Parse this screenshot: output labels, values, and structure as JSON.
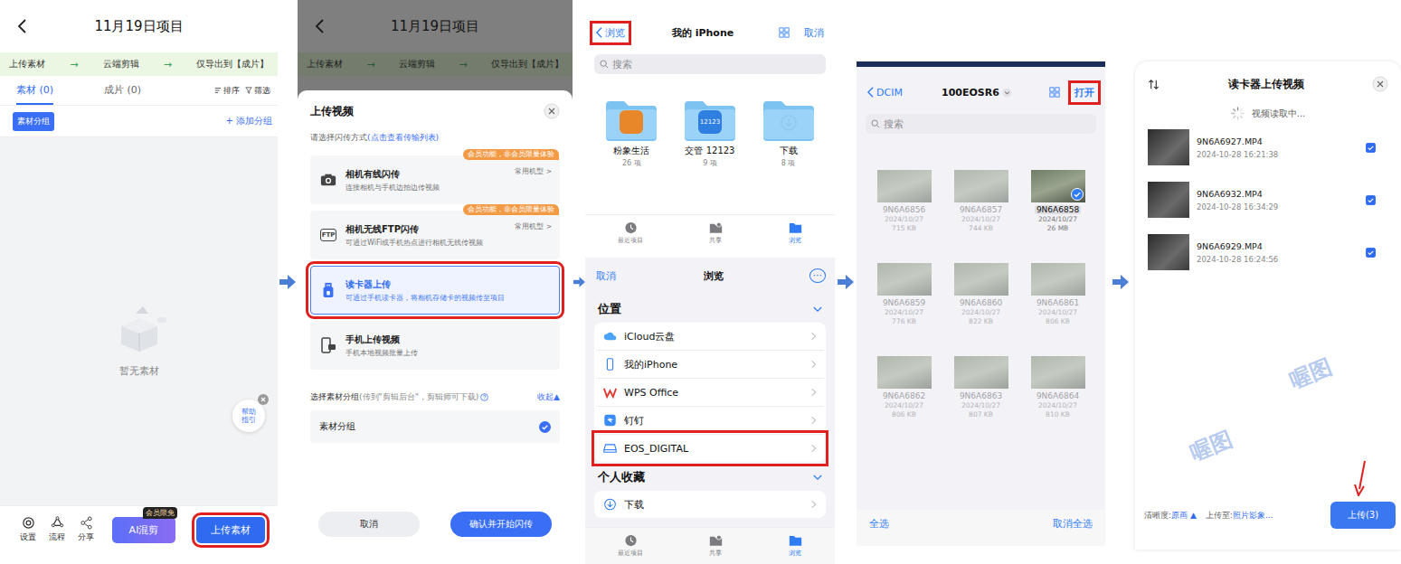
{
  "project": {
    "title": "11月19日项目",
    "steps": [
      "上传素材",
      "云端剪辑",
      "仅导出到【成片】"
    ],
    "step_arrow": "→",
    "tabs": [
      {
        "label": "素材 (0)",
        "selected": true
      },
      {
        "label": "成片 (0)",
        "selected": false
      }
    ],
    "tools": [
      {
        "label": "排序",
        "kind": "sort"
      },
      {
        "label": "筛选",
        "kind": "filter"
      }
    ],
    "group_button": "素材分组",
    "add_group": "+ 添加分组",
    "empty": "暂无素材",
    "help": [
      "帮助",
      "指引"
    ],
    "actions": [
      {
        "label": "设置",
        "kind": "gear"
      },
      {
        "label": "流程",
        "kind": "flow"
      },
      {
        "label": "分享",
        "kind": "share"
      }
    ],
    "ai_button": "AI混剪",
    "ai_badge": "会员限免",
    "upload": {
      "label": "上传素材",
      "highlighted": true
    }
  },
  "sheet": {
    "title": "上传视频",
    "hint": "请选择闪传方式",
    "hint_link": "(点击查看传输列表)",
    "methods": [
      {
        "title": "相机有线闪传",
        "desc": "连接相机与手机边拍边传视频",
        "badge": "会员功能，非会员限量体验",
        "tag": "常用机型 >",
        "kind": "camera",
        "icon_text": "",
        "selected": false,
        "highlighted": false
      },
      {
        "title": "相机无线FTP闪传",
        "desc": "可通过WiFi或手机热点进行相机无线传视频",
        "badge": "会员功能，非会员限量体验",
        "tag": "常用机型 >",
        "kind": "ftp",
        "icon_text": "FTP",
        "selected": false,
        "highlighted": false
      },
      {
        "title": "读卡器上传",
        "desc": "可通过手机读卡器，将相机存储卡的视频传至项目",
        "badge": "",
        "tag": "",
        "kind": "usb",
        "icon_text": "",
        "selected": true,
        "highlighted": true
      },
      {
        "title": "手机上传视频",
        "desc": "手机本地视频批量上传",
        "badge": "",
        "tag": "",
        "kind": "phone",
        "icon_text": "",
        "selected": false,
        "highlighted": false
      }
    ],
    "group_label": "选择素材分组",
    "group_hint": "(传到\"剪辑后台\"，剪辑师可下载)",
    "collapse": "收起▲",
    "group": {
      "name": "素材分组",
      "checked": true
    },
    "cancel": "取消",
    "confirm": "确认并开始闪传"
  },
  "picker": {
    "back": {
      "label": "浏览",
      "highlighted": true
    },
    "title": "我的 iPhone",
    "cancel": "取消",
    "search": "搜索",
    "folders": [
      {
        "name": "粉象生活",
        "count": "26 项",
        "kind": "app",
        "color": "#e8862a",
        "icon_text": ""
      },
      {
        "name": "交管 12123",
        "count": "9 项",
        "kind": "app",
        "color": "#2f7fe0",
        "icon_text": "12123"
      },
      {
        "name": "下载",
        "count": "8 项",
        "kind": "download",
        "color": "#8fc9f0",
        "icon_text": ""
      }
    ]
  },
  "browse": {
    "cancel": "取消",
    "title": "浏览",
    "more": "···",
    "sections": [
      {
        "title": "位置",
        "items": [
          {
            "label": "iCloud云盘",
            "kind": "cloud",
            "highlighted": false
          },
          {
            "label": "我的iPhone",
            "kind": "phone",
            "highlighted": false
          },
          {
            "label": "WPS Office",
            "kind": "wps",
            "highlighted": false
          },
          {
            "label": "钉钉",
            "kind": "ding",
            "highlighted": false
          },
          {
            "label": "EOS_DIGITAL",
            "kind": "drive",
            "highlighted": true
          }
        ]
      },
      {
        "title": "个人收藏",
        "items": [
          {
            "label": "下载",
            "kind": "download",
            "highlighted": false
          }
        ]
      }
    ]
  },
  "tabbar": [
    {
      "label": "最近项目",
      "kind": "recent",
      "selected": false
    },
    {
      "label": "共享",
      "kind": "shared",
      "selected": false
    },
    {
      "label": "浏览",
      "kind": "browse",
      "selected": true
    }
  ],
  "dcim": {
    "back": "DCIM",
    "title": "100EOSR6",
    "open": {
      "label": "打开",
      "highlighted": true
    },
    "search": "搜索",
    "files": [
      {
        "name": "9N6A6856",
        "date": "2024/10/27",
        "size": "715 KB",
        "selected": false
      },
      {
        "name": "9N6A6857",
        "date": "2024/10/27",
        "size": "744 KB",
        "selected": false
      },
      {
        "name": "9N6A6858",
        "date": "2024/10/27",
        "size": "26 MB",
        "selected": true
      },
      {
        "name": "9N6A6859",
        "date": "2024/10/27",
        "size": "776 KB",
        "selected": false
      },
      {
        "name": "9N6A6860",
        "date": "2024/10/27",
        "size": "822 KB",
        "selected": false
      },
      {
        "name": "9N6A6861",
        "date": "2024/10/27",
        "size": "806 KB",
        "selected": false
      },
      {
        "name": "9N6A6862",
        "date": "2024/10/27",
        "size": "806 KB",
        "selected": false
      },
      {
        "name": "9N6A6863",
        "date": "2024/10/27",
        "size": "807 KB",
        "selected": false
      },
      {
        "name": "9N6A6864",
        "date": "2024/10/27",
        "size": "810 KB",
        "selected": false
      }
    ],
    "select_all": "全选",
    "deselect_all": "取消全选"
  },
  "reader": {
    "title": "读卡器上传视频",
    "loading": "视频读取中...",
    "videos": [
      {
        "name": "9N6A6927.MP4",
        "time": "2024-10-28 16:21:38",
        "checked": true
      },
      {
        "name": "9N6A6932.MP4",
        "time": "2024-10-28 16:34:29",
        "checked": true
      },
      {
        "name": "9N6A6929.MP4",
        "time": "2024-10-28 16:24:56",
        "checked": true
      }
    ],
    "quality_label": "清晰度:",
    "quality": "原画 ▲",
    "dest_label": "上传至:",
    "dest": "照片影象...",
    "upload": {
      "label": "上传(3)",
      "marked": true
    }
  },
  "watermark": "喔图"
}
